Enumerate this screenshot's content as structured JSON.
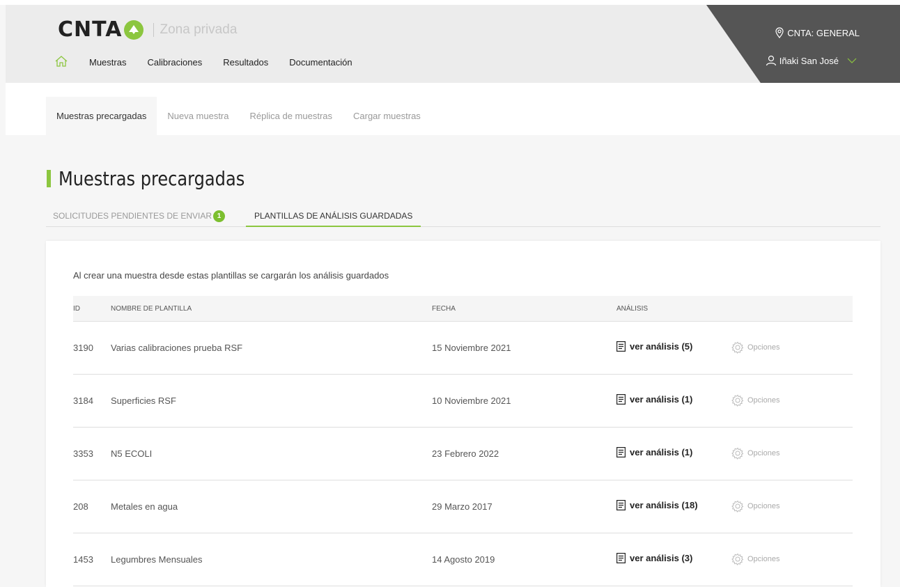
{
  "header": {
    "logo_text": "CNTA",
    "zone": "Zona privada",
    "nav": [
      "Muestras",
      "Calibraciones",
      "Resultados",
      "Documentación"
    ],
    "location": "CNTA: GENERAL",
    "user": "Iñaki San José"
  },
  "subtabs": [
    "Muestras precargadas",
    "Nueva muestra",
    "Réplica de muestras",
    "Cargar muestras"
  ],
  "page": {
    "title": "Muestras precargadas",
    "tab_pending": "SOLICITUDES PENDIENTES DE ENVIAR",
    "tab_pending_count": "1",
    "tab_saved": "PLANTILLAS DE ANÁLISIS GUARDADAS",
    "intro": "Al crear una muestra desde estas plantillas se cargarán los análisis guardados"
  },
  "table": {
    "headers": [
      "ID",
      "NOMBRE DE PLANTILLA",
      "FECHA",
      "ANÁLISIS"
    ],
    "options_label": "Opciones",
    "rows": [
      {
        "id": "3190",
        "name": "Varias calibraciones prueba RSF",
        "date": "15 Noviembre 2021",
        "analysis": "ver análisis (5)"
      },
      {
        "id": "3184",
        "name": "Superficies RSF",
        "date": "10 Noviembre 2021",
        "analysis": "ver análisis (1)"
      },
      {
        "id": "3353",
        "name": "N5 ECOLI",
        "date": "23 Febrero 2022",
        "analysis": "ver análisis (1)"
      },
      {
        "id": "208",
        "name": "Metales en agua",
        "date": "29 Marzo 2017",
        "analysis": "ver análisis (18)"
      },
      {
        "id": "1453",
        "name": "Legumbres Mensuales",
        "date": "14 Agosto 2019",
        "analysis": "ver análisis (3)"
      }
    ]
  },
  "colors": {
    "accent": "#8cc63f",
    "header_bg": "#ececec",
    "dark_panel": "#555555"
  }
}
